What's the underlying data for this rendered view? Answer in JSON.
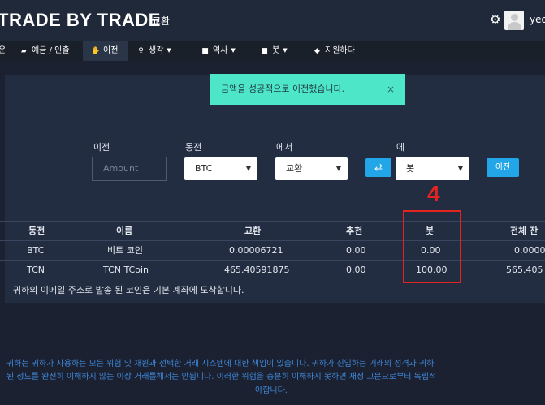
{
  "header": {
    "brand": "TRADE BY TRADE",
    "exchange_link": "교환",
    "username": "yeo"
  },
  "nav": {
    "partial_first": "운",
    "items": [
      {
        "label": "예금 / 인출",
        "icon": "wallet-icon",
        "has_caret": false
      },
      {
        "label": "이전",
        "icon": "hand-icon",
        "has_caret": false,
        "active": true
      },
      {
        "label": "생각",
        "icon": "lightbulb-icon",
        "has_caret": true
      },
      {
        "label": "역사",
        "icon": "list-icon",
        "has_caret": true
      },
      {
        "label": "봇",
        "icon": "robot-icon",
        "has_caret": true
      },
      {
        "label": "지원하다",
        "icon": "tag-icon",
        "has_caret": false
      }
    ]
  },
  "toast": {
    "message": "금액을 성공적으로 이전했습니다.",
    "close": "×"
  },
  "transfer_form": {
    "amount_label": "이전",
    "amount_placeholder": "Amount",
    "coin_label": "동전",
    "coin_value": "BTC",
    "from_label": "에서",
    "from_value": "교환",
    "to_label": "에",
    "to_value": "봇",
    "submit_label": "이전"
  },
  "annotation": {
    "marker": "4"
  },
  "table": {
    "headers": [
      "동전",
      "이름",
      "교환",
      "추천",
      "봇",
      "전체 잔"
    ],
    "rows": [
      [
        "BTC",
        "비트 코인",
        "0.00006721",
        "0.00",
        "0.00",
        "0.0000"
      ],
      [
        "TCN",
        "TCN TCoin",
        "465.40591875",
        "0.00",
        "100.00",
        "565.405"
      ]
    ]
  },
  "note": "귀하의 이메일 주소로 발송 된 코인은 기본 계좌에 도착합니다.",
  "footer": {
    "line1": "귀하는 귀하가 사용하는 모든 위험 및 재원과 선택한 거래 시스템에 대한 책임이 있습니다. 귀하가 진입하는 거래의 성격과 귀하",
    "line2": "된 정도를 완전히 이해하지 않는 이상 거래를해서는 안됩니다. 이러한 위험을 충분히 이해하지 못하면 재정 고문으로부터 독립적",
    "line3": "야합니다."
  }
}
